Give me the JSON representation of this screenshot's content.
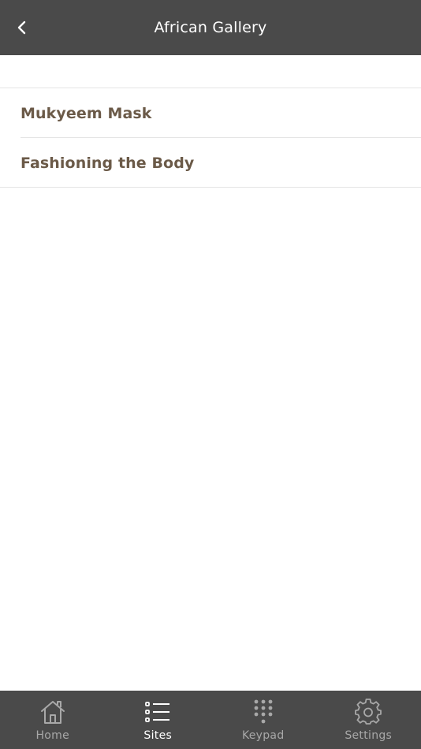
{
  "header": {
    "title": "African Gallery",
    "back_icon": "chevron-left-icon"
  },
  "list": {
    "items": [
      {
        "label": "Mukyeem Mask"
      },
      {
        "label": "Fashioning the Body"
      }
    ]
  },
  "tabbar": {
    "active": "Sites",
    "tabs": [
      {
        "label": "Home",
        "icon": "home-icon"
      },
      {
        "label": "Sites",
        "icon": "list-icon"
      },
      {
        "label": "Keypad",
        "icon": "keypad-icon"
      },
      {
        "label": "Settings",
        "icon": "gear-icon"
      }
    ]
  },
  "colors": {
    "header_bg": "#4a4a4a",
    "tabbar_bg": "#4a4a4a",
    "item_text": "#6b5a48",
    "tab_inactive": "#a8a8a8",
    "tab_active": "#ffffff"
  }
}
